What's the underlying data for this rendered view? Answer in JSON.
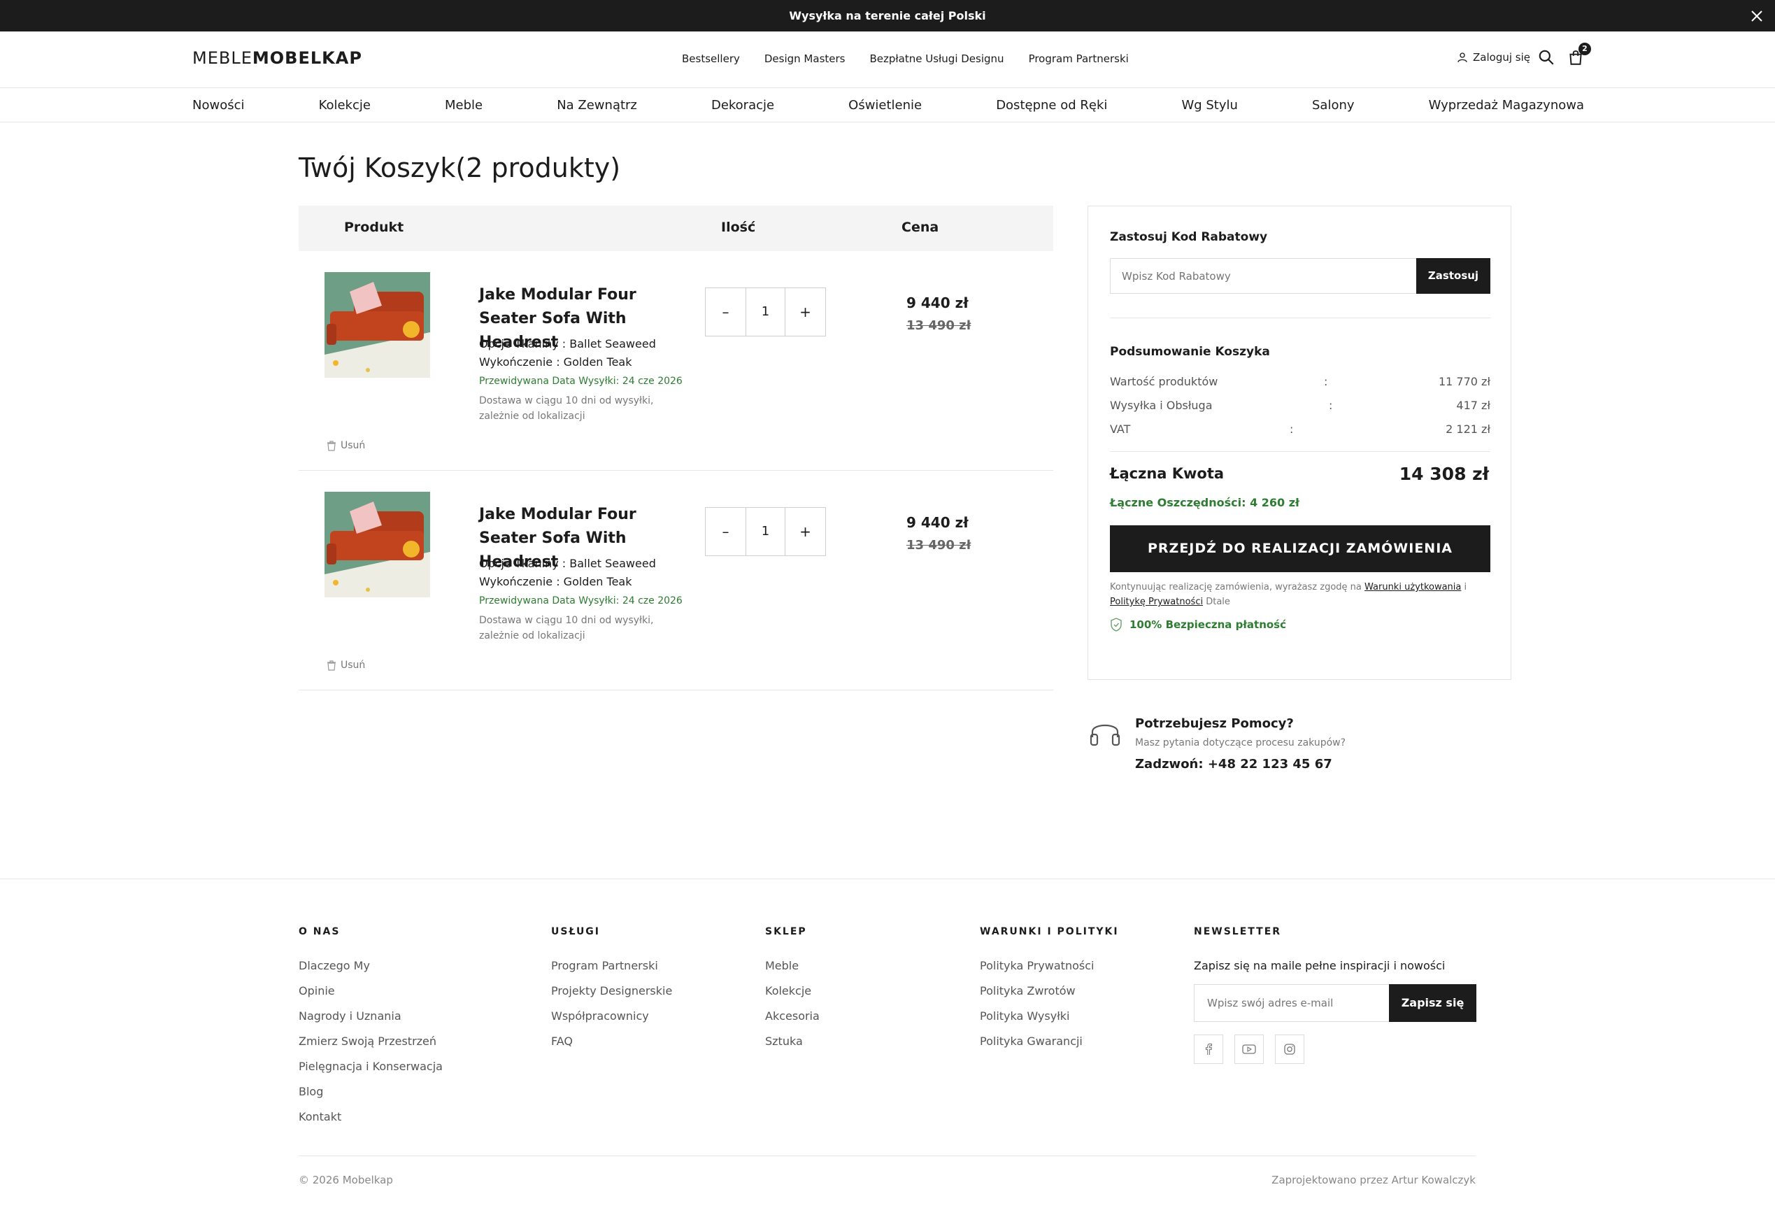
{
  "topbar": {
    "message": "Wysyłka na terenie całej Polski"
  },
  "header": {
    "logo_light": "MEBLE",
    "logo_bold": "MOBELKAP",
    "nav": [
      "Bestsellery",
      "Design Masters",
      "Bezpłatne Usługi Designu",
      "Program Partnerski"
    ],
    "login": "Zaloguj się",
    "cart_count": "2"
  },
  "mainnav": [
    "Nowości",
    "Kolekcje",
    "Meble",
    "Na Zewnątrz",
    "Dekoracje",
    "Oświetlenie",
    "Dostępne od Ręki",
    "Wg Stylu",
    "Salony",
    "Wyprzedaż Magazynowa"
  ],
  "page": {
    "title": "Twój Koszyk(2 produkty)"
  },
  "cart": {
    "headers": {
      "product": "Produkt",
      "qty": "Ilość",
      "price": "Cena"
    },
    "items": [
      {
        "name": "Jake Modular Four Seater Sofa With Headrest",
        "fabric": "Opcje Tkaniny : Ballet Seaweed",
        "finish": "Wykończenie : Golden Teak",
        "ship_date": "Przewidywana Data Wysyłki: 24 cze 2026",
        "delivery": "Dostawa w ciągu 10 dni od wysyłki, zależnie od lokalizacji",
        "qty": "1",
        "qty_minus": "–",
        "qty_plus": "+",
        "price": "9 440 zł",
        "old_price": "13 490 zł",
        "remove": "Usuń"
      },
      {
        "name": "Jake Modular Four Seater Sofa With Headrest",
        "fabric": "Opcje Tkaniny : Ballet Seaweed",
        "finish": "Wykończenie : Golden Teak",
        "ship_date": "Przewidywana Data Wysyłki: 24 cze 2026",
        "delivery": "Dostawa w ciągu 10 dni od wysyłki, zależnie od lokalizacji",
        "qty": "1",
        "qty_minus": "–",
        "qty_plus": "+",
        "price": "9 440 zł",
        "old_price": "13 490 zł",
        "remove": "Usuń"
      }
    ]
  },
  "summary": {
    "coupon_title": "Zastosuj Kod Rabatowy",
    "coupon_placeholder": "Wpisz Kod Rabatowy",
    "coupon_button": "Zastosuj",
    "summary_title": "Podsumowanie Koszyka",
    "rows": [
      {
        "label": "Wartość produktów",
        "sep": ":",
        "value": "11 770 zł"
      },
      {
        "label": "Wysyłka i Obsługa",
        "sep": ":",
        "value": "417 zł"
      },
      {
        "label": "VAT",
        "sep": ":",
        "value": "2 121 zł"
      }
    ],
    "total_label": "Łączna Kwota",
    "total_value": "14 308 zł",
    "savings": "Łączne Oszczędności: 4 260 zł",
    "checkout": "PRZEJDŹ DO REALIZACJI ZAMÓWIENIA",
    "terms_pre": "Kontynuując realizację zamówienia, wyrażasz zgodę na ",
    "terms_link1": "Warunki użytkowania",
    "terms_mid": " i ",
    "terms_link2": "Politykę Prywatności",
    "terms_post": " Dtale",
    "secure": "100% Bezpieczna płatność"
  },
  "help": {
    "title": "Potrzebujesz Pomocy?",
    "subtitle": "Masz pytania dotyczące procesu zakupów?",
    "call": "Zadzwoń: +48 22 123 45 67"
  },
  "footer": {
    "cols": [
      {
        "title": "O NAS",
        "links": [
          "Dlaczego My",
          "Opinie",
          "Nagrody i Uznania",
          "Zmierz Swoją Przestrzeń",
          "Pielęgnacja i Konserwacja",
          "Blog",
          "Kontakt"
        ]
      },
      {
        "title": "USŁUGI",
        "links": [
          "Program Partnerski",
          "Projekty Designerskie",
          "Współpracownicy",
          "FAQ"
        ]
      },
      {
        "title": "SKLEP",
        "links": [
          "Meble",
          "Kolekcje",
          "Akcesoria",
          "Sztuka"
        ]
      },
      {
        "title": "WARUNKI I POLITYKI",
        "links": [
          "Polityka Prywatności",
          "Polityka Zwrotów",
          "Polityka Wysyłki",
          "Polityka Gwarancji"
        ]
      }
    ],
    "newsletter": {
      "title": "NEWSLETTER",
      "text": "Zapisz się na maile pełne inspiracji i nowości",
      "placeholder": "Wpisz swój adres e-mail",
      "button": "Zapisz się"
    },
    "copyright": "© 2026 Mobelkap",
    "designed": "Zaprojektowano przez Artur Kowalczyk"
  },
  "colors": {
    "dark": "#1c1c1c",
    "green": "#2e7d32",
    "sofa": "#c2441f",
    "bg_photo": "#6e9e86"
  },
  "icons": [
    "close-icon",
    "user-icon",
    "search-icon",
    "cart-icon",
    "trash-icon",
    "shield-check-icon",
    "headset-icon",
    "facebook-icon",
    "youtube-icon",
    "instagram-icon"
  ]
}
